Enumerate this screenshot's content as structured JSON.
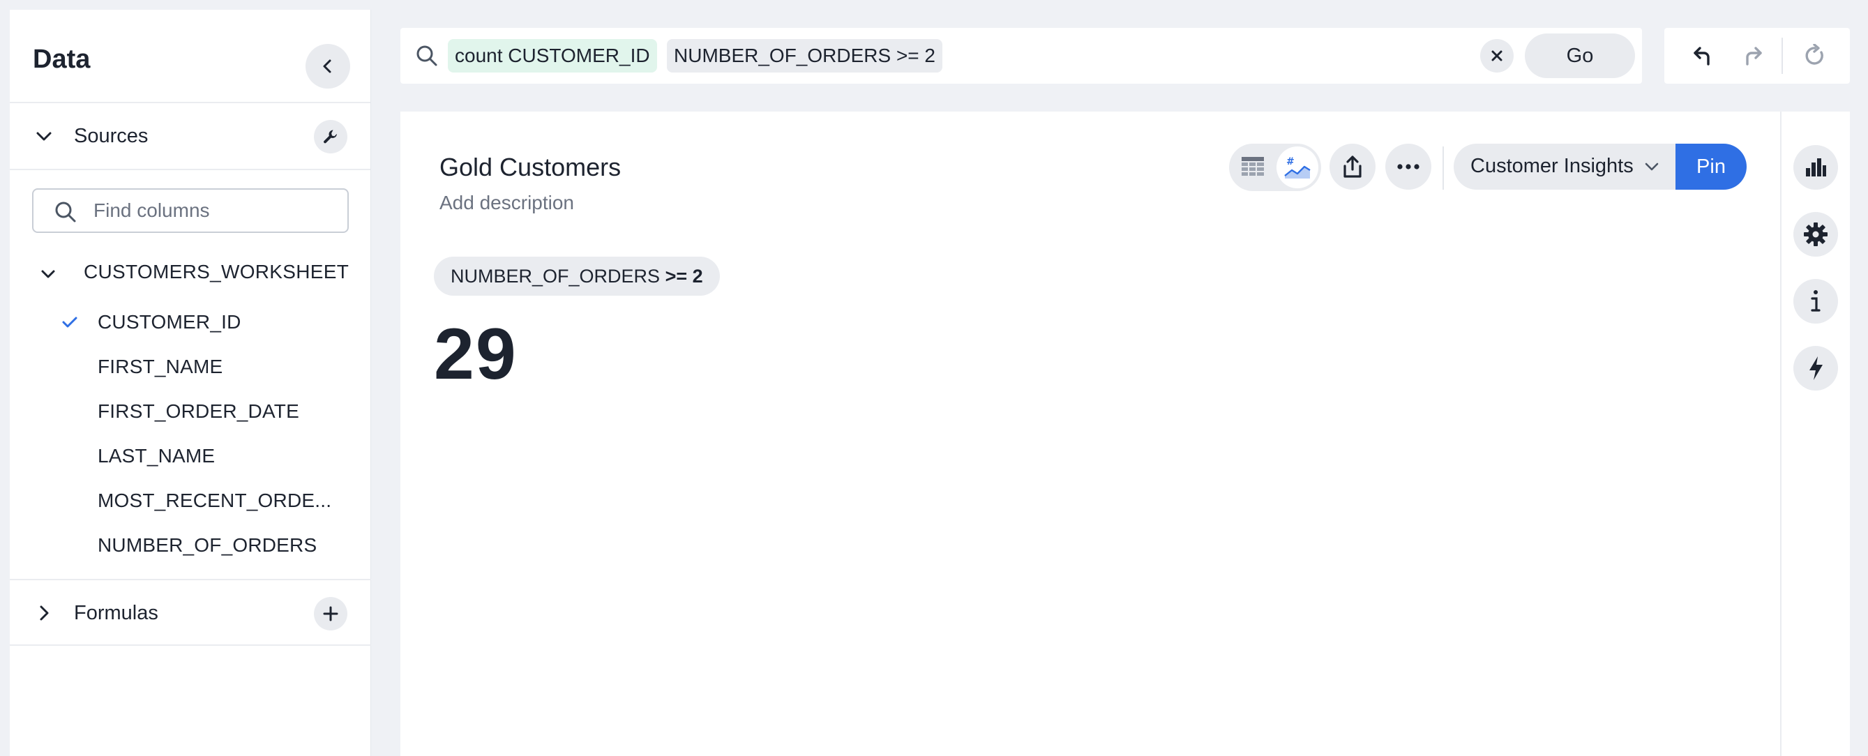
{
  "data_panel": {
    "title": "Data",
    "sources_label": "Sources",
    "find_placeholder": "Find columns",
    "worksheet_name": "CUSTOMERS_WORKSHEET",
    "columns": [
      {
        "label": "CUSTOMER_ID",
        "selected": true
      },
      {
        "label": "FIRST_NAME",
        "selected": false
      },
      {
        "label": "FIRST_ORDER_DATE",
        "selected": false
      },
      {
        "label": "LAST_NAME",
        "selected": false
      },
      {
        "label": "MOST_RECENT_ORDE...",
        "selected": false
      },
      {
        "label": "NUMBER_OF_ORDERS",
        "selected": false
      }
    ],
    "formulas_label": "Formulas"
  },
  "search": {
    "tokens": [
      {
        "text": "count CUSTOMER_ID",
        "kind": "measure"
      },
      {
        "text": "NUMBER_OF_ORDERS >= 2",
        "kind": "filter"
      }
    ],
    "go_label": "Go"
  },
  "viz": {
    "title": "Gold Customers",
    "description": "Add description",
    "liveboard": "Customer Insights",
    "pin_label": "Pin",
    "filter_chip": {
      "column": "NUMBER_OF_ORDERS",
      "condition": ">= 2"
    },
    "kpi_value": "29"
  },
  "icons": {
    "search": "search-icon",
    "collapse": "chevron-left-icon",
    "wrench": "wrench-icon",
    "add": "plus-icon",
    "check": "check-icon",
    "clear": "close-icon",
    "undo": "undo-icon",
    "redo": "redo-icon",
    "reset": "reset-icon",
    "table": "table-icon",
    "chart": "kpi-chart-icon",
    "share": "share-icon",
    "more": "more-icon",
    "rail": [
      "bar-chart-icon",
      "gear-icon",
      "info-icon",
      "lightning-icon"
    ]
  },
  "colors": {
    "primary": "#2f6fe4",
    "measure_token_bg": "#e1f5ec",
    "page_bg": "#eff1f5"
  }
}
